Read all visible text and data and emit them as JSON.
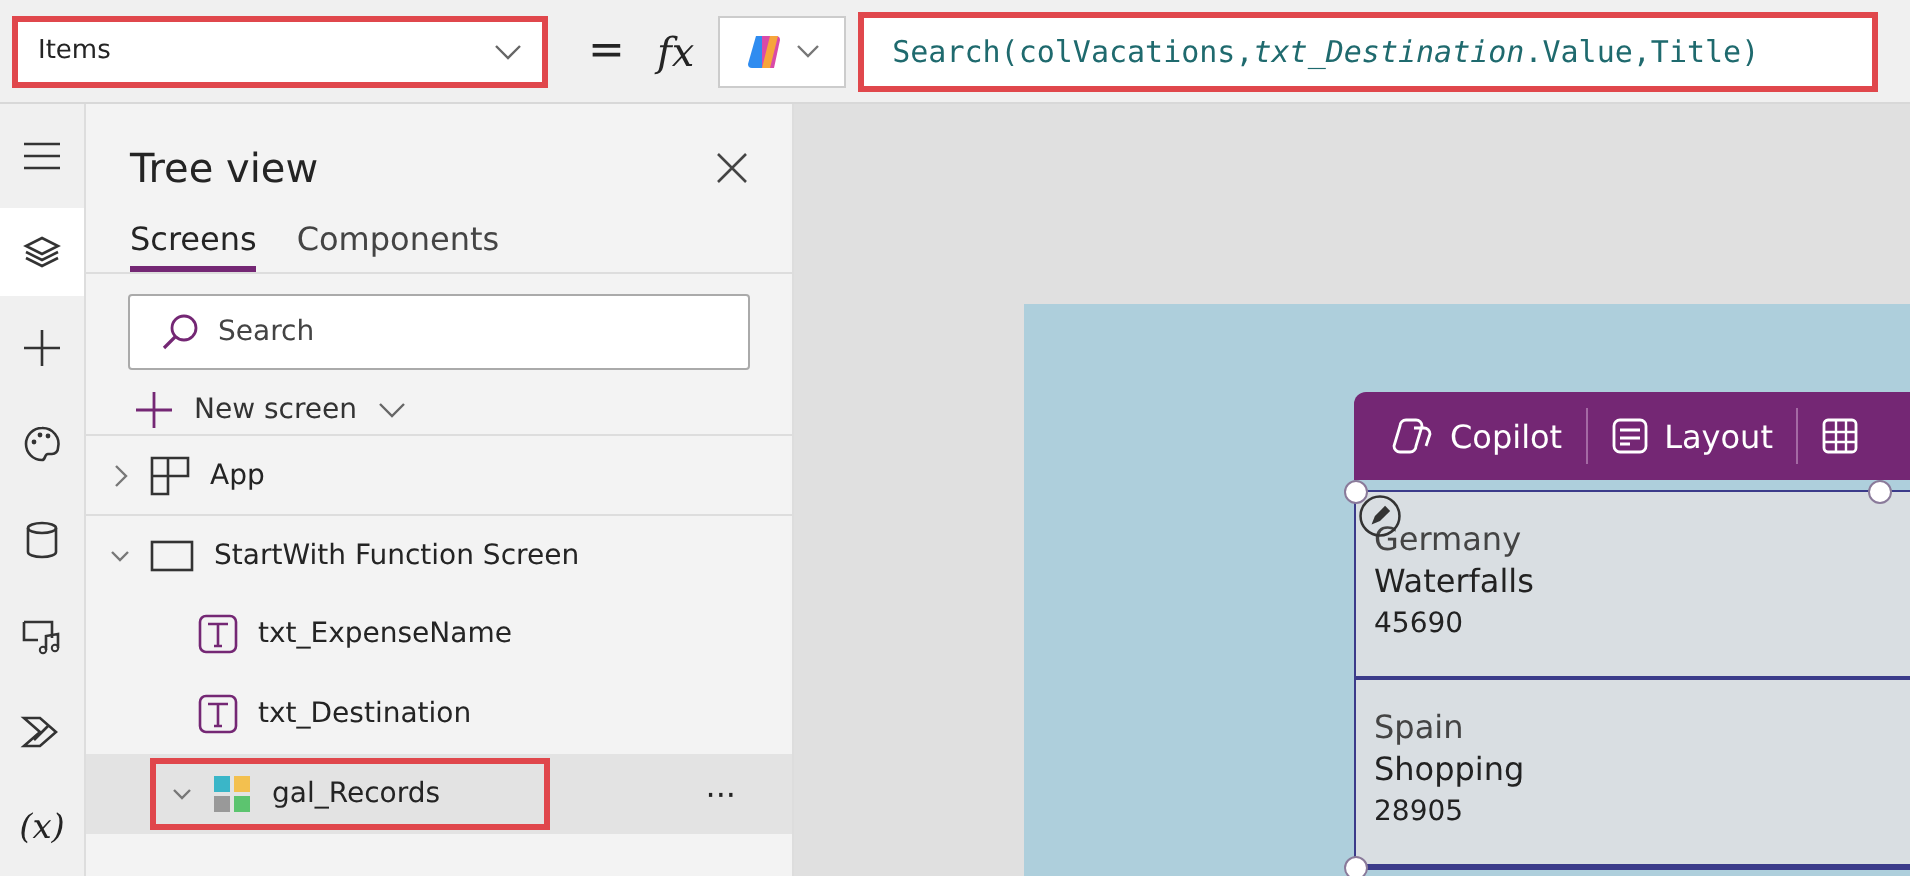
{
  "formula_bar": {
    "property": "Items",
    "highlighted": true,
    "equals": "=",
    "fx": "fx",
    "formula": "Search(colVacations,*txt_Destination*.Value,Title)"
  },
  "rail": [
    {
      "kind": "menu",
      "selected": false
    },
    {
      "kind": "layers",
      "selected": true
    },
    {
      "kind": "plus",
      "selected": false
    },
    {
      "kind": "palette",
      "selected": false
    },
    {
      "kind": "database",
      "selected": false
    },
    {
      "kind": "media",
      "selected": false
    },
    {
      "kind": "flow",
      "selected": false
    },
    {
      "kind": "variables",
      "label": "(x)",
      "selected": false
    }
  ],
  "tree_view": {
    "title": "Tree view",
    "tabs": [
      {
        "label": "Screens",
        "selected": true
      },
      {
        "label": "Components",
        "selected": false
      }
    ],
    "search": {
      "placeholder": "Search"
    },
    "new_screen": "New screen",
    "items": [
      {
        "kind": "app",
        "label": "App",
        "expanded": false
      },
      {
        "kind": "screen",
        "label": "StartWith Function Screen",
        "expanded": true,
        "children": [
          {
            "kind": "text",
            "label": "txt_ExpenseName"
          },
          {
            "kind": "text",
            "label": "txt_Destination"
          },
          {
            "kind": "gallery",
            "label": "gal_Records",
            "expanded": true,
            "selected": true,
            "highlighted": true,
            "more": "···"
          }
        ]
      }
    ]
  },
  "canvas": {
    "toolbar": [
      {
        "kind": "copilot",
        "label": "Copilot"
      },
      {
        "kind": "layout",
        "label": "Layout"
      },
      {
        "kind": "table"
      }
    ],
    "gallery": [
      {
        "title": "Germany",
        "subtitle": "Waterfalls",
        "body": "45690"
      },
      {
        "title": "Spain",
        "subtitle": "Shopping",
        "body": "28905"
      }
    ]
  }
}
